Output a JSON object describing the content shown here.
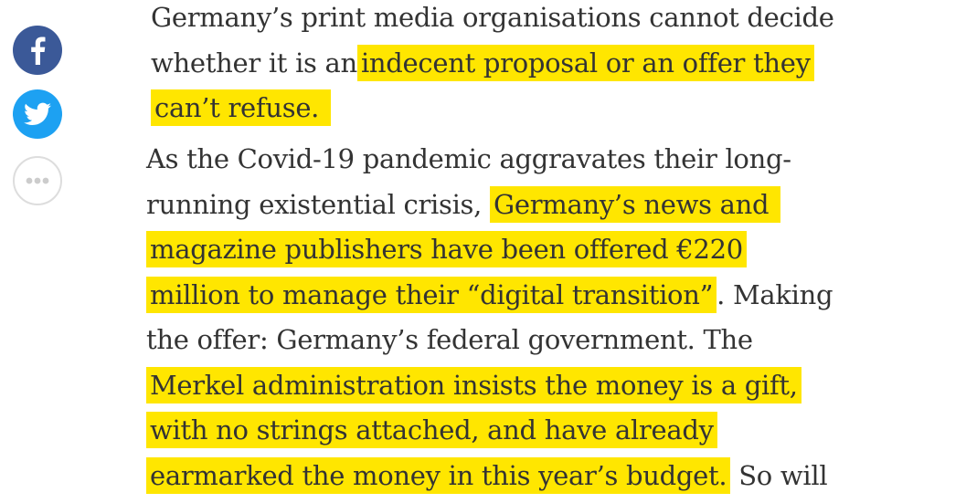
{
  "share": {
    "facebook_color": "#3b5998",
    "twitter_color": "#1da1f2",
    "more_border_color": "#dddddd",
    "icons": [
      "facebook-icon",
      "twitter-icon",
      "more-dots-icon"
    ]
  },
  "highlight_color": "#ffe600",
  "paragraph1": {
    "lines": [
      [
        "Germany’s print media organisations cannot decide",
        ""
      ],
      [
        "whether it is an",
        "indecent proposal or an offer they"
      ],
      [
        "",
        "can’t refuse. "
      ]
    ]
  },
  "paragraph2": {
    "lines": [
      [
        "As the Covid-19 pandemic aggravates their long-",
        "",
        ""
      ],
      [
        "running existential crisis,",
        "Germany’s news and ",
        ""
      ],
      [
        "",
        "magazine publishers have been offered €220",
        ""
      ],
      [
        "",
        "million to manage their “digital transition”",
        ". Making"
      ],
      [
        "the offer: Germany’s federal government. The",
        "",
        ""
      ],
      [
        "",
        "Merkel administration insists the money is a gift,",
        ""
      ],
      [
        "",
        "with no strings attached, and have already",
        ""
      ],
      [
        "",
        "earmarked the money in this year’s budget.",
        " So will"
      ]
    ]
  }
}
